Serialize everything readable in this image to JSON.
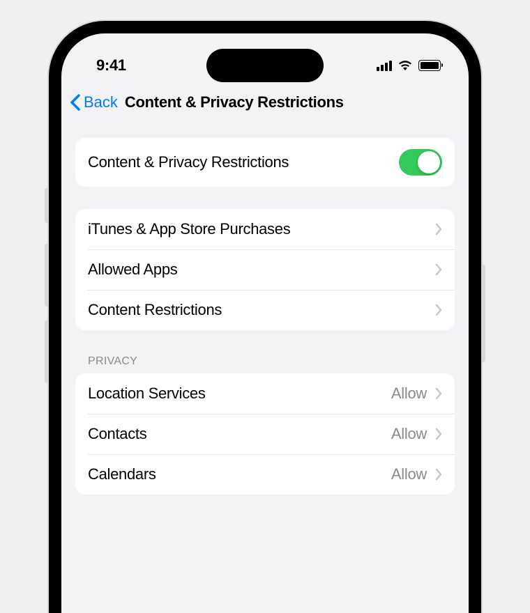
{
  "status": {
    "time": "9:41"
  },
  "nav": {
    "back_label": "Back",
    "title": "Content & Privacy Restrictions"
  },
  "toggle_row": {
    "label": "Content & Privacy Restrictions",
    "enabled": true
  },
  "main_items": [
    {
      "label": "iTunes & App Store Purchases"
    },
    {
      "label": "Allowed Apps"
    },
    {
      "label": "Content Restrictions"
    }
  ],
  "privacy_header": "Privacy",
  "privacy_items": [
    {
      "label": "Location Services",
      "value": "Allow"
    },
    {
      "label": "Contacts",
      "value": "Allow"
    },
    {
      "label": "Calendars",
      "value": "Allow"
    }
  ]
}
